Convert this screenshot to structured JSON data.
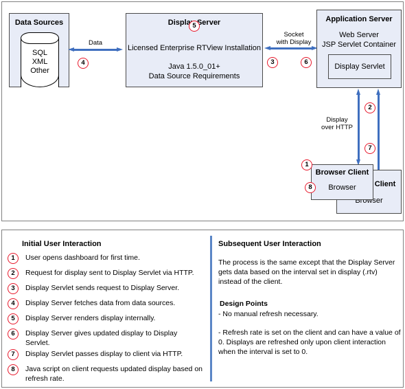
{
  "diagram": {
    "data_sources": {
      "title": "Data Sources",
      "cylinder_lines": "SQL\nXML\nOther"
    },
    "display_server": {
      "title": "Display Server",
      "line1": "Licensed Enterprise RTView Installation",
      "line2": "Java 1.5.0_01+",
      "line3": "Data Source Requirements"
    },
    "application_server": {
      "title": "Application Server",
      "line1": "Web Server",
      "line2": "JSP Servlet Container",
      "servlet_label": "Display Servlet"
    },
    "browser_client_back": {
      "title": "Browser Client",
      "line1": "Browser"
    },
    "browser_client_front": {
      "title": "Browser Client",
      "line1": "Browser"
    },
    "labels": {
      "data": "Data",
      "socket": "Socket\nwith Display",
      "http": "Display\nover HTTP"
    },
    "badges": {
      "data_arrow": "4",
      "display_server": "5",
      "socket_left": "3",
      "socket_right": "6",
      "http_top": "2",
      "http_bottom": "7",
      "client_top": "1",
      "client_bottom": "8"
    },
    "colors": {
      "arrow": "#3f6fbf",
      "badge_border": "#e8192c",
      "box_fill": "#e8ecf7",
      "box_border": "#4a4a4a",
      "panel_border": "#808080",
      "divider": "#5b86c6"
    }
  },
  "legend": {
    "initial": {
      "heading": "Initial User Interaction",
      "steps": [
        {
          "num": "1",
          "text": "User opens dashboard for first time."
        },
        {
          "num": "2",
          "text": "Request for display sent to Display Servlet via HTTP."
        },
        {
          "num": "3",
          "text": "Display Servlet sends request to Display Server."
        },
        {
          "num": "4",
          "text": "Display Server fetches data from data sources."
        },
        {
          "num": "5",
          "text": "Display Server renders display internally."
        },
        {
          "num": "6",
          "text": "Display Server gives updated display to Display Servlet."
        },
        {
          "num": "7",
          "text": "Display Servlet passes display to client via HTTP."
        },
        {
          "num": "8",
          "text": "Java script on client requests updated display based on refresh rate."
        }
      ]
    },
    "subsequent": {
      "heading": "Subsequent User Interaction",
      "paragraph": "The process is the same except that the Display Server gets data based on the interval set in display (.rtv) instead of the client.",
      "design_heading": "Design Points",
      "design_point_1": "- No manual refresh necessary.",
      "design_point_2": "- Refresh rate is set on the client and can have a value of 0. Displays are refreshed only upon client interaction when the interval is set to 0."
    }
  }
}
